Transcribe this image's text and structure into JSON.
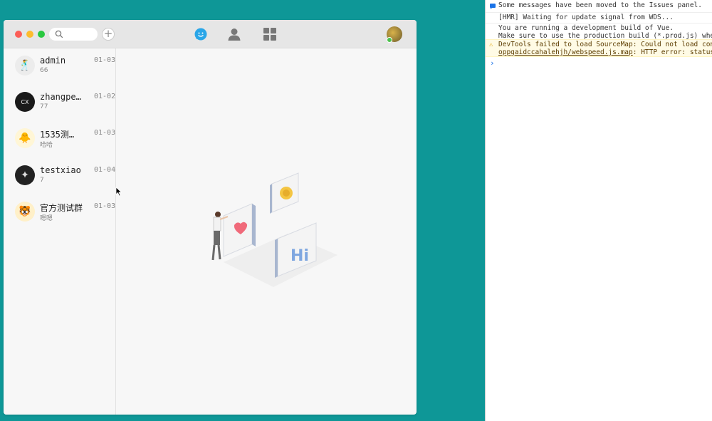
{
  "app": {
    "nav": {
      "chat_icon": "chat-bubble-icon",
      "contacts_icon": "person-icon",
      "apps_icon": "grid-icon"
    },
    "add_label": "+",
    "conversations": [
      {
        "name": "admin",
        "last_message": "66",
        "date": "01-03",
        "avatar_color": "#e9e9e9",
        "avatar_glyph": "🕺"
      },
      {
        "name": "zhangpe…",
        "last_message": "77",
        "date": "01-02",
        "avatar_color": "#1a1a1a",
        "avatar_glyph": "CX"
      },
      {
        "name": "1535测试…",
        "last_message": "哈哈",
        "date": "01-03",
        "avatar_color": "#fff6d6",
        "avatar_glyph": "🐥"
      },
      {
        "name": "testxiao",
        "last_message": "7",
        "date": "01-04",
        "avatar_color": "#222222",
        "avatar_glyph": "✦"
      },
      {
        "name": "官方测试群",
        "last_message": "嗯嗯",
        "date": "01-03",
        "avatar_color": "#fff0c8",
        "avatar_glyph": "🐯"
      }
    ]
  },
  "console": {
    "messages": [
      {
        "type": "info",
        "text": "Some messages have been moved to the Issues panel."
      },
      {
        "type": "log",
        "text": "[HMR] Waiting for update signal from WDS..."
      },
      {
        "type": "log",
        "text": "You are running a development build of Vue.",
        "text2": "Make sure to use the production build (*.prod.js) when de"
      },
      {
        "type": "warning",
        "text": "DevTools failed to load SourceMap: Could not load content",
        "link": "oppgaidccahalehjh/webspeed.js.map",
        "text2": ": HTTP error: status cod"
      }
    ],
    "prompt": "›"
  }
}
